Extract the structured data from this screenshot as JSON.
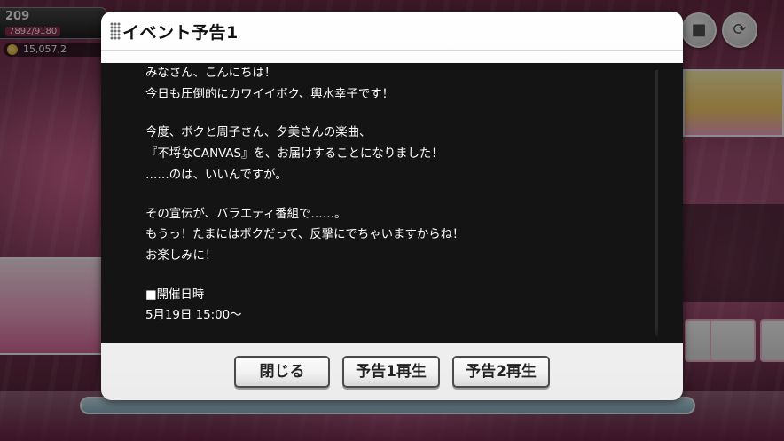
{
  "hud": {
    "level": "209",
    "stamina": "7892/9180",
    "money": "15,057,2"
  },
  "dialog": {
    "title": "イベント予告1",
    "paragraphs": [
      [
        "みなさん、こんにちは！",
        "今日も圧倒的にカワイイボク、輿水幸子です！"
      ],
      [
        "今度、ボクと周子さん、夕美さんの楽曲、",
        "『不埒なCANVAS』を、お届けすることになりました！",
        "……のは、いいんですが。"
      ],
      [
        "その宣伝が、バラエティ番組で……。",
        "もうっ！たまにはボクだって、反撃にでちゃいますからね！",
        "お楽しみに！"
      ],
      [
        "■開催日時",
        "5月19日 15:00〜"
      ]
    ],
    "buttons": {
      "close": "閉じる",
      "preview1": "予告1再生",
      "preview2": "予告2再生"
    }
  },
  "colors": {
    "dialog_bg": "#ffffff",
    "content_bg": "#141414",
    "content_text": "#ffffff",
    "button_border": "#4a4a4a"
  },
  "icons": {
    "grip": "grip-dots-icon",
    "camera": "camera-icon",
    "rotate": "rotate-screen-icon",
    "coin": "coin-icon"
  }
}
